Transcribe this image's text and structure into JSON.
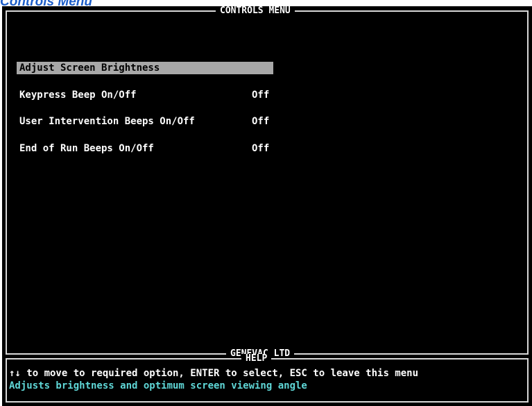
{
  "page_caption": "Controls Menu",
  "main_panel": {
    "title": "CONTROLS MENU",
    "footer": "GENEVAC LTD"
  },
  "menu": {
    "items": [
      {
        "label": "Adjust Screen Brightness",
        "value": "",
        "selected": true
      },
      {
        "label": "Keypress Beep On/Off",
        "value": "Off",
        "selected": false
      },
      {
        "label": "User Intervention Beeps On/Off",
        "value": "Off",
        "selected": false
      },
      {
        "label": "End of Run Beeps On/Off",
        "value": "Off",
        "selected": false
      }
    ]
  },
  "help_panel": {
    "title": "HELP",
    "instructions": "↑↓ to move to required option, ENTER to select, ESC to leave this menu",
    "description": "Adjusts brightness and optimum screen viewing angle"
  },
  "colors": {
    "screen_background": "#000000",
    "text": "#ffffff",
    "highlight_bar": "#a8a8a8",
    "help_description": "#5fd7d7",
    "caption": "#1d5ec9"
  }
}
